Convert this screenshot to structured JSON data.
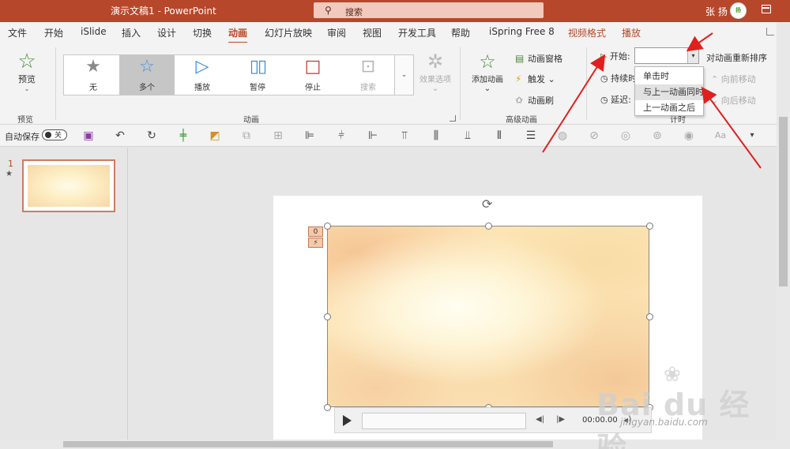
{
  "titlebar": {
    "doc_title": "演示文稿1  -  PowerPoint",
    "search_placeholder": "搜索",
    "user_name": "张 扬",
    "avatar_text": "扬"
  },
  "tabs": [
    "文件",
    "开始",
    "iSlide",
    "插入",
    "设计",
    "切换",
    "动画",
    "幻灯片放映",
    "审阅",
    "视图",
    "开发工具",
    "帮助",
    "iSpring Free 8",
    "视频格式",
    "播放"
  ],
  "active_tab": "动画",
  "ribbon": {
    "preview": {
      "label": "预览",
      "group": "预览"
    },
    "gallery": {
      "items": [
        {
          "label": "无"
        },
        {
          "label": "多个"
        },
        {
          "label": "播放"
        },
        {
          "label": "暂停"
        },
        {
          "label": "停止"
        },
        {
          "label": "搜索"
        }
      ],
      "selected": "多个",
      "effects_label": "效果选项",
      "group": "动画"
    },
    "advanced": {
      "add_animation": "添加动画",
      "pane": "动画窗格",
      "trigger": "触发",
      "painter": "动画刷",
      "group": "高级动画"
    },
    "timing": {
      "start_label": "开始:",
      "start_value": "",
      "duration_label": "持续时",
      "delay_label": "延迟:",
      "reorder_label": "对动画重新排序",
      "move_earlier": "向前移动",
      "move_later": "向后移动",
      "group": "计时",
      "dropdown": [
        "单击时",
        "与上一动画同时",
        "上一动画之后"
      ],
      "hovered": "与上一动画同时"
    }
  },
  "qat": {
    "autosave_label": "自动保存",
    "toggle_state": "关"
  },
  "thumbnails": {
    "slide_number": "1",
    "anim_marker": "★"
  },
  "slide": {
    "tags": [
      "0",
      "⚡"
    ],
    "time": "00:00.00"
  },
  "watermark": {
    "brand": "Bai du 经验",
    "url": "jingyan.baidu.com"
  },
  "colors": {
    "accent": "#b7472a",
    "annotation": "#e0201e"
  }
}
